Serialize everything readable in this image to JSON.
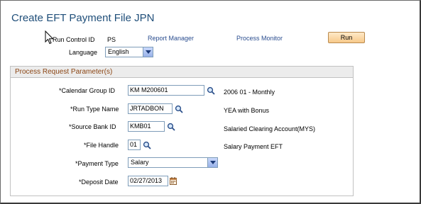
{
  "page": {
    "title": "Create EFT Payment File JPN"
  },
  "run_control": {
    "label": "Run Control ID",
    "value": "PS",
    "report_manager": "Report Manager",
    "process_monitor": "Process Monitor",
    "run_button": "Run",
    "language_label": "Language",
    "language_value": "English"
  },
  "section": {
    "title": "Process Request Parameter(s)"
  },
  "fields": {
    "calendar_group": {
      "label": "*Calendar Group ID",
      "value": "KM M200601",
      "description": "2006 01 - Monthly"
    },
    "run_type": {
      "label": "*Run Type Name",
      "value": "JRTADBON",
      "description": "YEA with Bonus"
    },
    "source_bank": {
      "label": "*Source Bank ID",
      "value": "KMB01",
      "description": "Salaried Clearing Account(MYS)"
    },
    "file_handle": {
      "label": "*File Handle",
      "value": "01",
      "description": "Salary Payment EFT"
    },
    "payment_type": {
      "label": "*Payment Type",
      "value": "Salary"
    },
    "deposit_date": {
      "label": "*Deposit Date",
      "value": "02/27/2013"
    }
  },
  "icons": {
    "lookup": "magnifier-icon",
    "calendar": "calendar-icon",
    "cursor": "mouse-pointer-icon"
  },
  "colors": {
    "title": "#1f4e79",
    "link": "#2a4d8f",
    "section_title": "#8b4513",
    "run_button": "#f7c98a"
  }
}
